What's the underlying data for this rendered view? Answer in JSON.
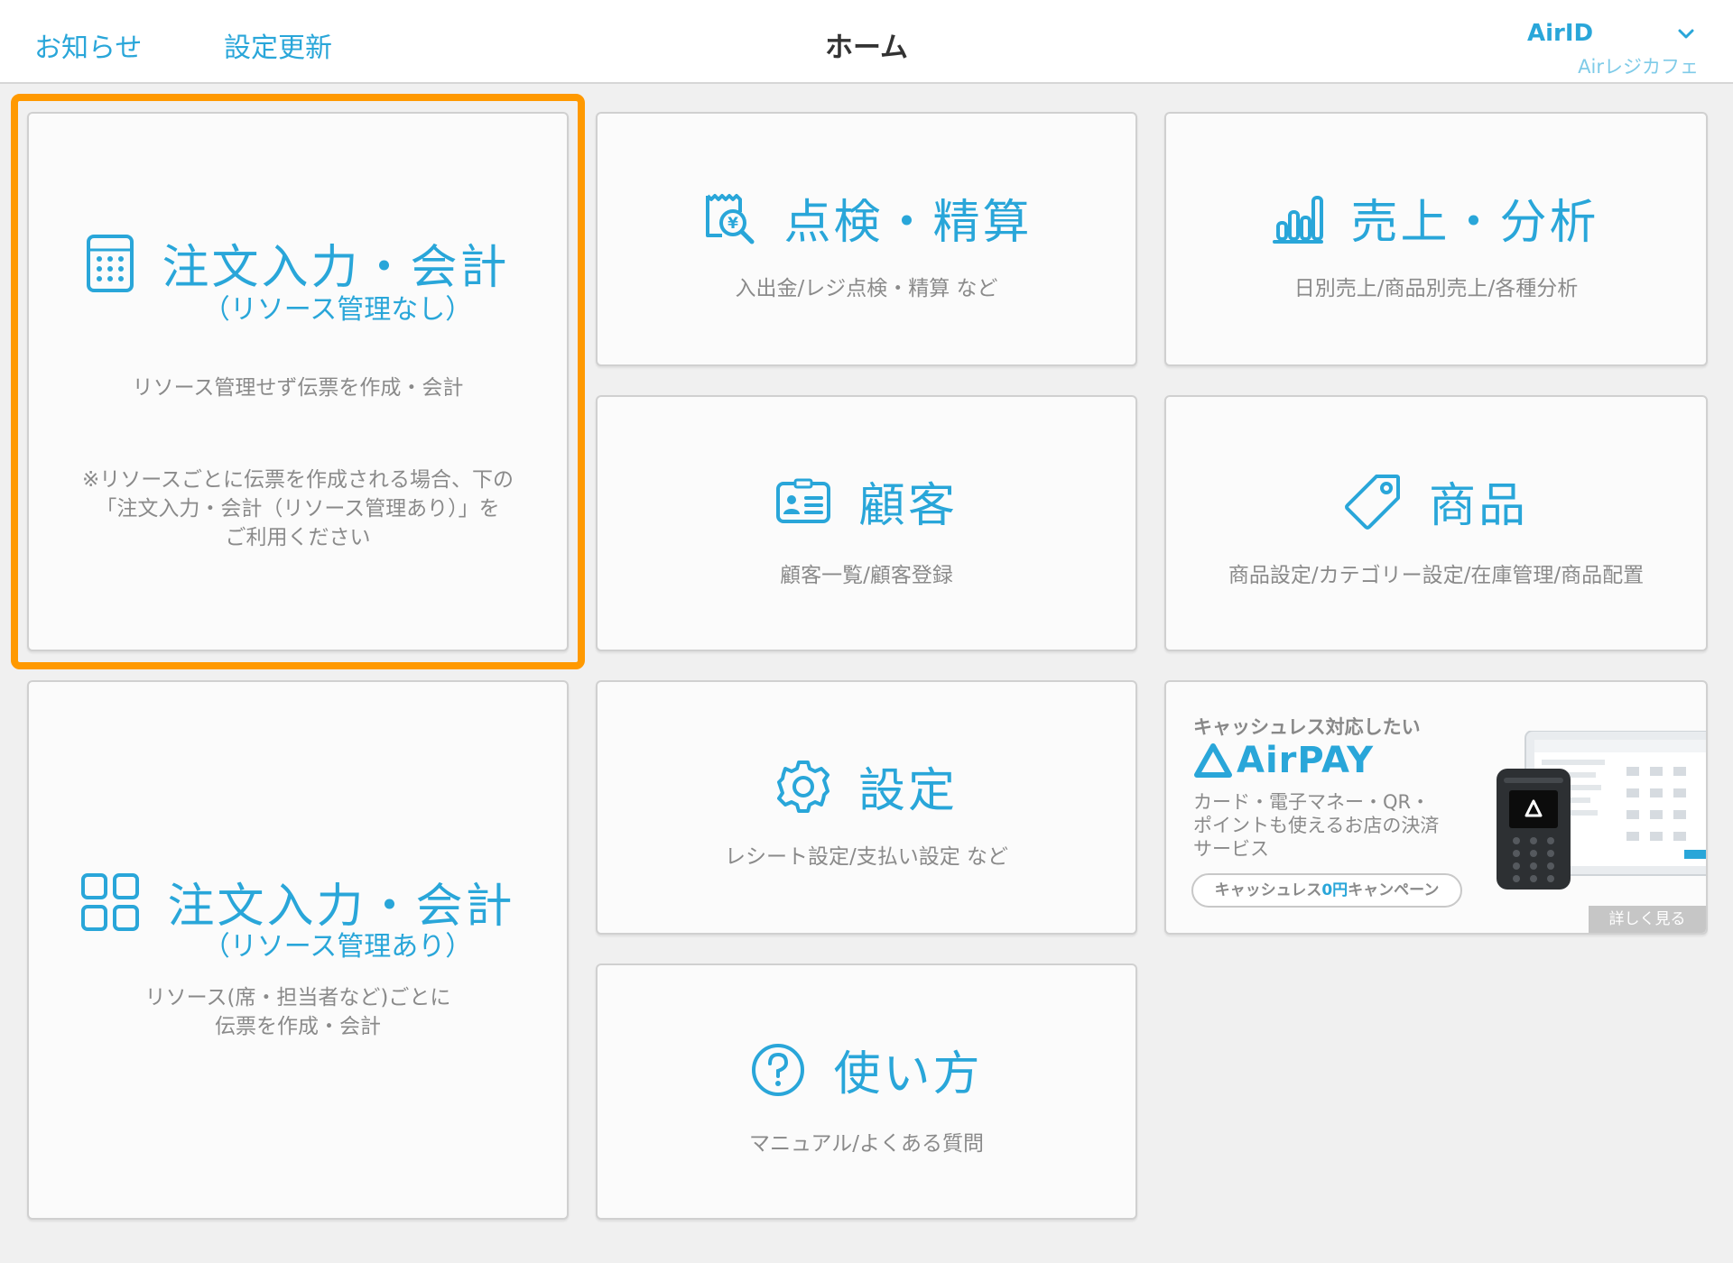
{
  "header": {
    "notice_label": "お知らせ",
    "update_label": "設定更新",
    "title": "ホーム",
    "account_label": "AirID",
    "store_name": "Airレジカフェ"
  },
  "tiles": {
    "order_no_resource": {
      "title": "注文入力・会計",
      "subtitle": "（リソース管理なし）",
      "description": "リソース管理せず伝票を作成・会計",
      "note_line1": "※リソースごとに伝票を作成される場合、下の",
      "note_line2": "「注文入力・会計（リソース管理あり）」を",
      "note_line3": "ご利用ください"
    },
    "order_with_resource": {
      "title": "注文入力・会計",
      "subtitle": "（リソース管理あり）",
      "description_line1": "リソース(席・担当者など)ごとに",
      "description_line2": "伝票を作成・会計"
    },
    "inspection": {
      "title": "点検・精算",
      "description": "入出金/レジ点検・精算 など"
    },
    "sales": {
      "title": "売上・分析",
      "description": "日別売上/商品別売上/各種分析"
    },
    "customer": {
      "title": "顧客",
      "description": "顧客一覧/顧客登録"
    },
    "product": {
      "title": "商品",
      "description": "商品設定/カテゴリー設定/在庫管理/商品配置"
    },
    "settings": {
      "title": "設定",
      "description": "レシート設定/支払い設定 など"
    },
    "howto": {
      "title": "使い方",
      "description": "マニュアル/よくある質問"
    }
  },
  "promo": {
    "headline": "キャッシュレス対応したい",
    "brand": "AirPAY",
    "text_line1": "カード・電子マネー・QR・",
    "text_line2": "ポイントも使えるお店の決済",
    "text_line3": "サービス",
    "campaign_pre": "キャッシュレス",
    "campaign_hl": "0円",
    "campaign_post": "キャンペーン",
    "more_label": "詳しく見る"
  },
  "colors": {
    "accent": "#29a6d9",
    "highlight": "#ff9900",
    "background": "#f0f0f0",
    "tile_background": "#fbfbfb"
  }
}
